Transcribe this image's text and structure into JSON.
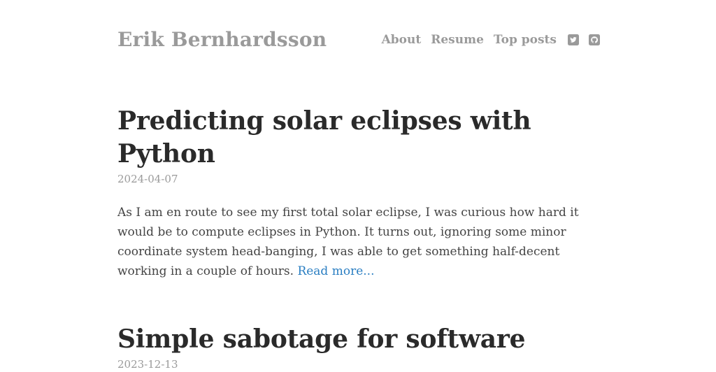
{
  "site": {
    "title": "Erik Bernhardsson"
  },
  "nav": {
    "items": [
      {
        "label": "About"
      },
      {
        "label": "Resume"
      },
      {
        "label": "Top posts"
      }
    ],
    "social": [
      {
        "icon": "twitter-icon"
      },
      {
        "icon": "github-icon"
      }
    ]
  },
  "posts": [
    {
      "title": "Predicting solar eclipses with Python",
      "date": "2024-04-07",
      "excerpt": "As I am en route to see my first total solar eclipse, I was curious how hard it would be to compute eclipses in Python. It turns out, ignoring some minor coordinate system head-banging, I was able to get something half-decent working in a couple of hours.",
      "read_more": "Read more..."
    },
    {
      "title": "Simple sabotage for software",
      "date": "2023-12-13"
    }
  ],
  "colors": {
    "muted": "#9a9a9a",
    "heading": "#2a2a2a",
    "body": "#444444",
    "link": "#2a7ec2"
  }
}
